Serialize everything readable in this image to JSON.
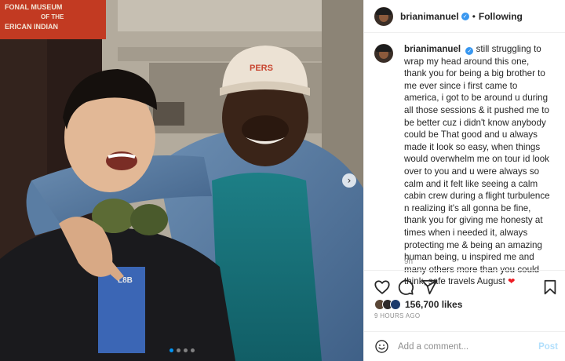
{
  "colors": {
    "link_blue": "#0095f6",
    "post_disabled": "#b2dffc",
    "verified_badge": "#3897f0",
    "meta_gray": "#8e8e8e",
    "heart_emoji_red": "#ed1c24"
  },
  "photo": {
    "sign_text_line1": "FONAL MUSEUM",
    "sign_text_line2": "OF THE",
    "sign_text_line3": "ERICAN INDIAN",
    "cap_text": "PERS",
    "shirt_text": "L8B",
    "carousel_next_icon": "chevron-right-icon",
    "carousel_dots": 4,
    "carousel_active_index": 0
  },
  "header": {
    "username": "brianimanuel",
    "verified_icon": "verified-badge-icon",
    "separator": "•",
    "follow_state": "Following"
  },
  "caption": {
    "username": "brianimanuel",
    "text": "still struggling to wrap my head around this one, thank you for being a big brother to me ever since i first came to america, i got to be around u during all those sessions & it pushed me to be better cuz i didn't know anybody could be That good and u always made it look so easy, when things would overwhelm me on tour id look over to you and u were always so calm and it felt like seeing a calm cabin crew during a flight turbulence n realizing it's all gonna be fine, thank you for giving me honesty at times when i needed it, always protecting me & being an amazing human being, u inspired me and many others more than you could think, safe travels August",
    "emoji": "❤",
    "time_ago": "9h"
  },
  "actions": {
    "like_icon": "heart-icon",
    "comment_icon": "comment-icon",
    "share_icon": "paper-plane-icon",
    "save_icon": "bookmark-icon"
  },
  "likes": {
    "count_text": "156,700 likes"
  },
  "timestamp": "9 HOURS AGO",
  "comment": {
    "emoji_icon": "smiley-icon",
    "placeholder": "Add a comment...",
    "post_label": "Post"
  }
}
